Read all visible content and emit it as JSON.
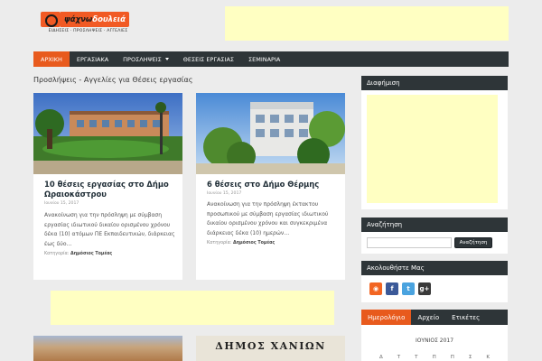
{
  "logo": {
    "part1": "ψάχνω",
    "part2": "δουλειά",
    "tagline": "ΕΙΔΗΣΕΙΣ · ΠΡΟΣΛΗΨΕΙΣ · ΑΓΓΕΛΙΕΣ"
  },
  "nav": {
    "items": [
      "ΑΡΧΙΚΗ",
      "ΕΡΓΑΣΙΑΚΑ",
      "ΠΡΟΣΛΗΨΕΙΣ",
      "ΘΕΣΕΙΣ ΕΡΓΑΣΙΑΣ",
      "ΣΕΜΙΝΑΡΙΑ"
    ]
  },
  "main": {
    "title": "Προσλήψεις - Αγγελίες για Θέσεις εργασίας",
    "posts": [
      {
        "title": "10 θέσεις εργασίας στο Δήμο Ωραιοκάστρου",
        "date": "Ιουνίου 15, 2017",
        "excerpt": "Ανακοίνωση για την πρόσληψη με σύμβαση εργασίας ιδιωτικού δικαίου ορισμένου χρόνου δέκα (10) ατόμων ΠΕ Εκπαιδευτικών, διάρκειας έως δύο…",
        "category_label": "Κατηγορία:",
        "category": "Δημόσιος Τομέας"
      },
      {
        "title": "6 θέσεις στο Δήμο Θέρμης",
        "date": "Ιουνίου 15, 2017",
        "excerpt": "Ανακοίνωση για την πρόσληψη έκτακτου προσωπικού με σύμβαση εργασίας ιδιωτικού δικαίου ορισμένου χρόνου και συγκεκριμένα διάρκειας δέκα (10) ημερών…",
        "category_label": "Κατηγορία:",
        "category": "Δημόσιος Τομέας"
      }
    ],
    "thumb2_text": "ΔΗΜΟΣ ΧΑΝΙΩΝ"
  },
  "sidebar": {
    "ad_title": "Διαφήμιση",
    "search_title": "Αναζήτηση",
    "search_placeholder": "",
    "search_button": "Αναζήτηση",
    "follow_title": "Ακολουθήστε Μας",
    "social": [
      {
        "icon": "rss-icon",
        "glyph": "◉",
        "color": "#f26522"
      },
      {
        "icon": "facebook-icon",
        "glyph": "f",
        "color": "#3b5998"
      },
      {
        "icon": "twitter-icon",
        "glyph": "t",
        "color": "#4aa3df"
      },
      {
        "icon": "google-plus-icon",
        "glyph": "g+",
        "color": "#3a3a3a"
      }
    ],
    "tabs": [
      "Ημερολόγιο",
      "Αρχείο",
      "Ετικέτες"
    ],
    "calendar_month": "ΙΟΥΝΙΟΣ 2017",
    "calendar_days": [
      "Δ",
      "Τ",
      "Τ",
      "Π",
      "Π",
      "Σ",
      "Κ"
    ]
  },
  "colors": {
    "accent": "#e85a1d",
    "dark": "#2e3538",
    "ad": "#ffffc2"
  }
}
